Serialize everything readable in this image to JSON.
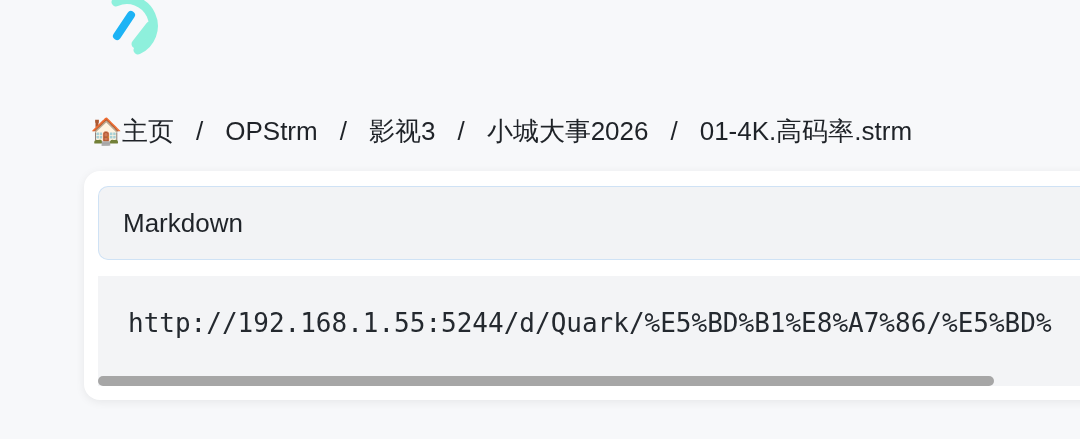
{
  "breadcrumb": {
    "items": [
      {
        "label": "🏠主页"
      },
      {
        "label": "OPStrm"
      },
      {
        "label": "影视3"
      },
      {
        "label": "小城大事2026"
      },
      {
        "label": "01-4K.高码率.strm"
      }
    ],
    "separators": [
      "/",
      "/",
      "/",
      "/"
    ]
  },
  "file_card": {
    "format": "Markdown",
    "code": "http://192.168.1.55:5244/d/Quark/%E5%BD%B1%E8%A7%86/%E5%BD%"
  }
}
